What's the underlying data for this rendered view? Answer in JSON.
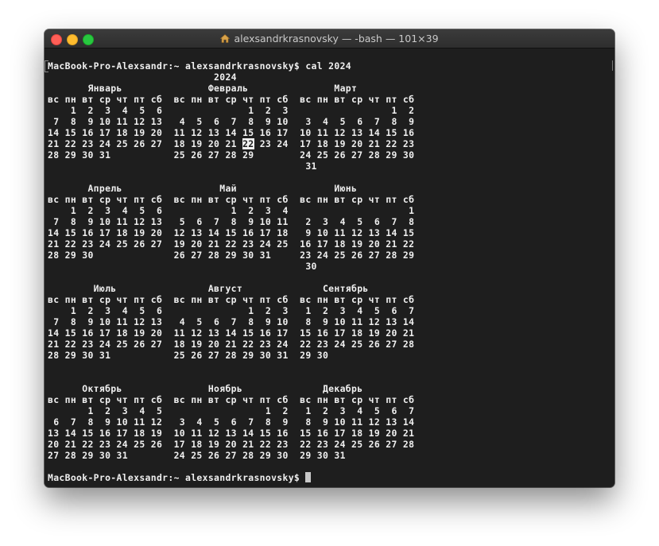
{
  "window": {
    "title": "alexsandrkrasnovsky — -bash — 101×39",
    "title_icon": "home-icon"
  },
  "terminal": {
    "prompt_command": "MacBook-Pro-Alexsandr:~ alexsandrkrasnovsky$ cal 2024",
    "calendar_lines": [
      "                             2024",
      "       Январь               Февраль               Март",
      "вс пн вт ср чт пт сб  вс пн вт ср чт пт сб  вс пн вт ср чт пт сб",
      "    1  2  3  4  5  6               1  2  3                  1  2",
      " 7  8  9 10 11 12 13   4  5  6  7  8  9 10   3  4  5  6  7  8  9",
      "14 15 16 17 18 19 20  11 12 13 14 15 16 17  10 11 12 13 14 15 16",
      "21 22 23 24 25 26 27  18 19 20 21 22 23 24  17 18 19 20 21 22 23",
      "28 29 30 31           25 26 27 28 29        24 25 26 27 28 29 30",
      "                                             31",
      "",
      "       Апрель                 Май                 Июнь",
      "вс пн вт ср чт пт сб  вс пн вт ср чт пт сб  вс пн вт ср чт пт сб",
      "    1  2  3  4  5  6            1  2  3  4                     1",
      " 7  8  9 10 11 12 13   5  6  7  8  9 10 11   2  3  4  5  6  7  8",
      "14 15 16 17 18 19 20  12 13 14 15 16 17 18   9 10 11 12 13 14 15",
      "21 22 23 24 25 26 27  19 20 21 22 23 24 25  16 17 18 19 20 21 22",
      "28 29 30              26 27 28 29 30 31     23 24 25 26 27 28 29",
      "                                             30",
      "",
      "        Июль                Август              Сентябрь",
      "вс пн вт ср чт пт сб  вс пн вт ср чт пт сб  вс пн вт ср чт пт сб",
      "    1  2  3  4  5  6               1  2  3   1  2  3  4  5  6  7",
      " 7  8  9 10 11 12 13   4  5  6  7  8  9 10   8  9 10 11 12 13 14",
      "14 15 16 17 18 19 20  11 12 13 14 15 16 17  15 16 17 18 19 20 21",
      "21 22 23 24 25 26 27  18 19 20 21 22 23 24  22 23 24 25 26 27 28",
      "28 29 30 31           25 26 27 28 29 30 31  29 30",
      "",
      "",
      "      Октябрь               Ноябрь              Декабрь",
      "вс пн вт ср чт пт сб  вс пн вт ср чт пт сб  вс пн вт ср чт пт сб",
      "       1  2  3  4  5                  1  2   1  2  3  4  5  6  7",
      " 6  7  8  9 10 11 12   3  4  5  6  7  8  9   8  9 10 11 12 13 14",
      "13 14 15 16 17 18 19  10 11 12 13 14 15 16  15 16 17 18 19 20 21",
      "20 21 22 23 24 25 26  17 18 19 20 21 22 23  22 23 24 25 26 27 28",
      "27 28 29 30 31        24 25 26 27 28 29 30  29 30 31"
    ],
    "today": "22",
    "final_prompt": "MacBook-Pro-Alexsandr:~ alexsandrkrasnovsky$ "
  },
  "colors": {
    "terminal_bg": "#1e1e1e",
    "text": "#f0f0f0",
    "today_highlight_bg": "#f2f2f2",
    "close": "#ff5f57",
    "minimize": "#febc2e",
    "zoom": "#28c840"
  }
}
